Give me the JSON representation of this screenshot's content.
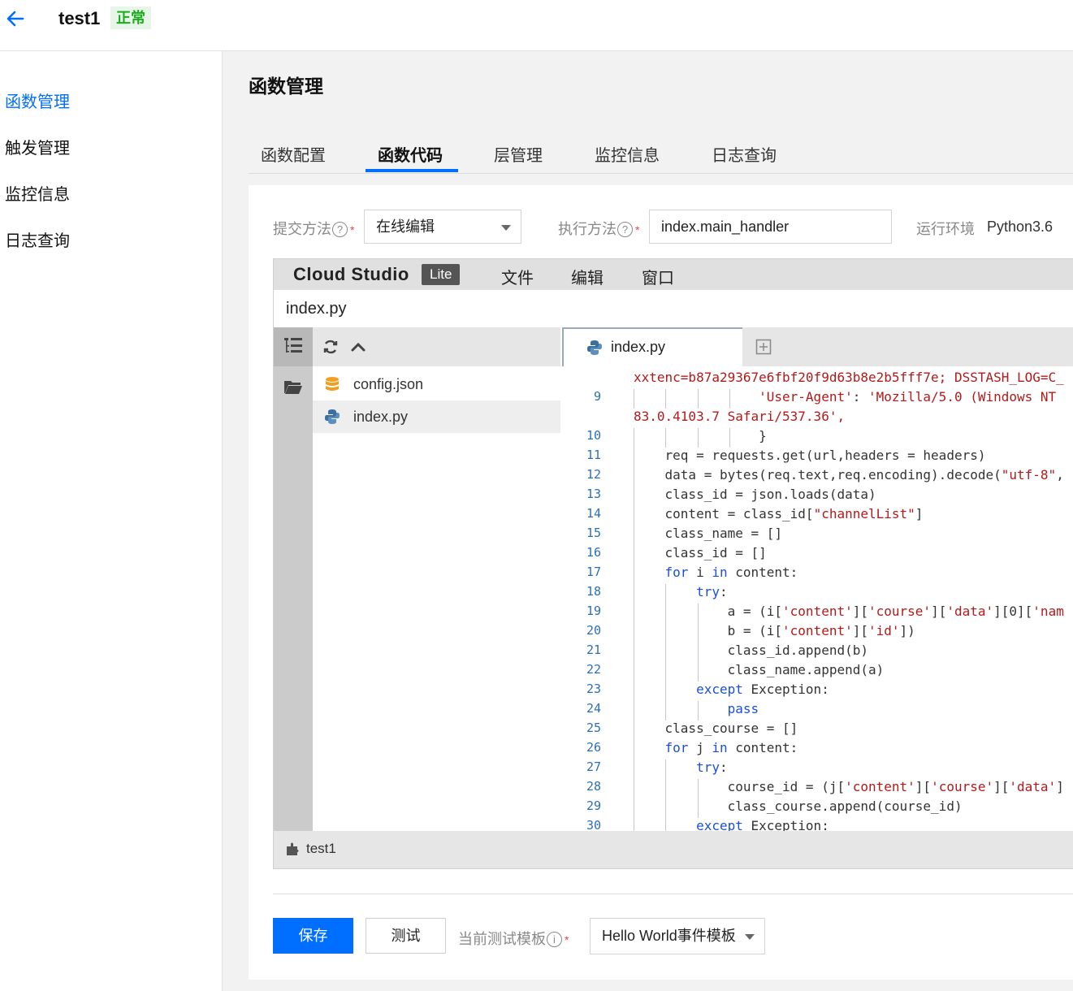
{
  "header": {
    "title": "test1",
    "status": "正常"
  },
  "sidebar": {
    "items": [
      {
        "label": "函数管理",
        "active": true
      },
      {
        "label": "触发管理"
      },
      {
        "label": "监控信息"
      },
      {
        "label": "日志查询"
      }
    ]
  },
  "page": {
    "title": "函数管理"
  },
  "tabs": [
    {
      "label": "函数配置"
    },
    {
      "label": "函数代码",
      "active": true
    },
    {
      "label": "层管理"
    },
    {
      "label": "监控信息"
    },
    {
      "label": "日志查询"
    }
  ],
  "form": {
    "submit_label": "提交方法",
    "submit_value": "在线编辑",
    "exec_label": "执行方法",
    "exec_value": "index.main_handler",
    "runtime_label": "运行环境",
    "runtime_value": "Python3.6"
  },
  "ide": {
    "brand": "Cloud Studio",
    "edition": "Lite",
    "menu": [
      "文件",
      "编辑",
      "窗口"
    ],
    "path": "index.py",
    "files": [
      "config.json",
      "index.py"
    ],
    "open_tab": "index.py",
    "status_name": "test1",
    "code_lines": [
      {
        "n": "",
        "t": "xxtenc=b87a29367e6fbf20f9d63b8e2b5fff7e; DSSTASH_LOG=C_"
      },
      {
        "n": "9",
        "t": "                'User-Agent': 'Mozilla/5.0 (Windows NT"
      },
      {
        "n": "",
        "t": "83.0.4103.7 Safari/537.36',"
      },
      {
        "n": "10",
        "t": "                }"
      },
      {
        "n": "11",
        "t": "    req = requests.get(url,headers = headers)"
      },
      {
        "n": "12",
        "t": "    data = bytes(req.text,req.encoding).decode(\"utf-8\","
      },
      {
        "n": "13",
        "t": "    class_id = json.loads(data)"
      },
      {
        "n": "14",
        "t": "    content = class_id[\"channelList\"]"
      },
      {
        "n": "15",
        "t": "    class_name = []"
      },
      {
        "n": "16",
        "t": "    class_id = []"
      },
      {
        "n": "17",
        "t": "    for i in content:"
      },
      {
        "n": "18",
        "t": "        try:"
      },
      {
        "n": "19",
        "t": "            a = (i['content']['course']['data'][0]['nam"
      },
      {
        "n": "20",
        "t": "            b = (i['content']['id'])"
      },
      {
        "n": "21",
        "t": "            class_id.append(b)"
      },
      {
        "n": "22",
        "t": "            class_name.append(a)"
      },
      {
        "n": "23",
        "t": "        except Exception:"
      },
      {
        "n": "24",
        "t": "            pass"
      },
      {
        "n": "25",
        "t": "    class_course = []"
      },
      {
        "n": "26",
        "t": "    for j in content:"
      },
      {
        "n": "27",
        "t": "        try:"
      },
      {
        "n": "28",
        "t": "            course_id = (j['content']['course']['data']"
      },
      {
        "n": "29",
        "t": "            class_course.append(course_id)"
      },
      {
        "n": "30",
        "t": "        except Exception:"
      }
    ]
  },
  "actions": {
    "save": "保存",
    "test": "测试",
    "template_label": "当前测试模板",
    "template_value": "Hello World事件模板"
  },
  "colors": {
    "accent": "#006eff",
    "status_green": "#1aad19",
    "required": "#e54545"
  }
}
